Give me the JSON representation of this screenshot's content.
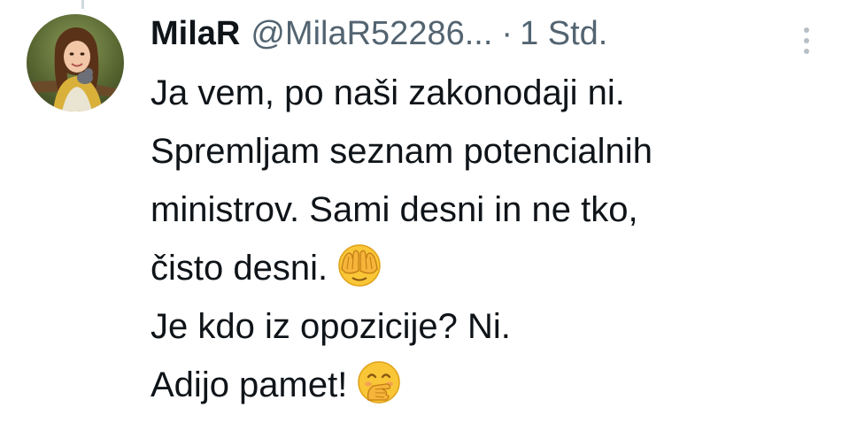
{
  "tweet": {
    "display_name": "MilaR",
    "handle": "@MilaR52286...",
    "separator": "·",
    "time": "1 Std.",
    "more_icon": "more-vertical-icon",
    "lines": [
      "Ja vem, po naši zakonodaji ni.",
      "Spremljam seznam potencialnih",
      "ministrov. Sami desni in ne tko,",
      "čisto desni.",
      "Je kdo iz opozicije? Ni.",
      "Adijo pamet!"
    ],
    "emoji": {
      "line4": "face-with-hands-over-eyes-emoji",
      "line6": "face-with-hand-over-mouth-emoji"
    }
  }
}
